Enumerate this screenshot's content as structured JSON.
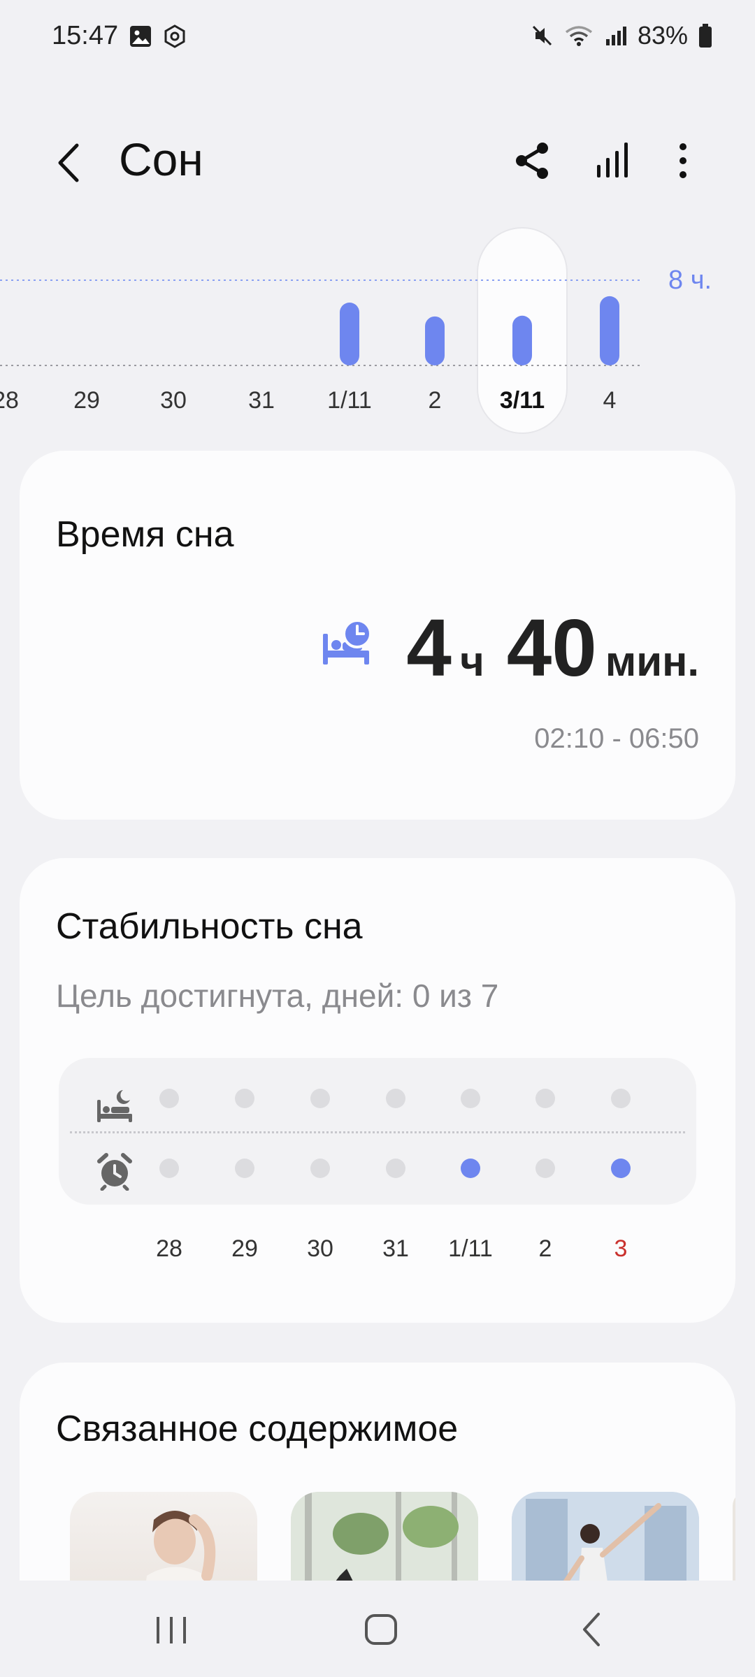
{
  "status_bar": {
    "time": "15:47",
    "battery": "83%",
    "icons": [
      "gallery-icon",
      "app-icon",
      "mute-icon",
      "wifi-icon",
      "signal-icon",
      "battery-icon"
    ]
  },
  "header": {
    "title": "Сон",
    "icons": [
      "back-icon",
      "share-icon",
      "stats-icon",
      "more-icon"
    ]
  },
  "chart": {
    "goal_label": "8 ч.",
    "days": [
      "28",
      "29",
      "30",
      "31",
      "1/11",
      "2",
      "3/11",
      "4"
    ],
    "selected_day": "3/11"
  },
  "chart_data": {
    "type": "bar",
    "categories": [
      "28",
      "29",
      "30",
      "31",
      "1/11",
      "2",
      "3/11",
      "4"
    ],
    "values": [
      null,
      null,
      null,
      null,
      5.9,
      4.6,
      4.67,
      6.5
    ],
    "units": "hours",
    "goal": 8,
    "ylim": [
      0,
      8
    ],
    "color": "#6e86ef"
  },
  "sleep_time": {
    "title": "Время сна",
    "hours": "4",
    "hours_unit": "ч",
    "minutes": "40",
    "minutes_unit": "мин.",
    "range": "02:10 - 06:50"
  },
  "consistency": {
    "title": "Стабильность сна",
    "goal_text": "Цель достигнута, дней: 0 из 7",
    "days": [
      "28",
      "29",
      "30",
      "31",
      "1/11",
      "2",
      "3"
    ],
    "bedtime_met": [
      false,
      false,
      false,
      false,
      false,
      false,
      false
    ],
    "wakeup_met": [
      false,
      false,
      false,
      false,
      true,
      false,
      true
    ]
  },
  "related": {
    "title": "Связанное содержимое"
  },
  "colors": {
    "accent": "#6e86ef",
    "background": "#f1f1f4",
    "card": "#fcfcfd",
    "today": "#c9302c"
  }
}
